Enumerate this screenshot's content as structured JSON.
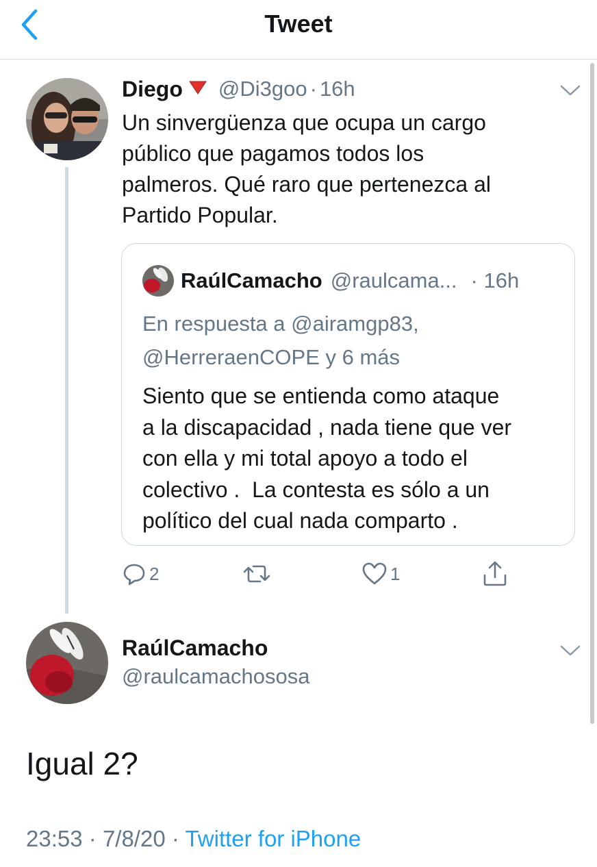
{
  "header": {
    "title": "Tweet",
    "back_icon": "chevron-left-icon"
  },
  "colors": {
    "accent": "#1da1f2",
    "text": "#14171a",
    "secondary": "#657786",
    "border": "#ccd6dd",
    "thread_line": "#cfd9de"
  },
  "tweet1": {
    "name": "Diego",
    "flag_icon": "red-down-triangle-icon",
    "handle": "@Di3goo",
    "sep": "·",
    "time": "16h",
    "text_lines": [
      "Un sinvergüenza que ocupa un cargo",
      "público que pagamos todos los",
      "palmeros. Qué raro que pertenezca al",
      "Partido Popular."
    ],
    "quote": {
      "name": "RaúlCamacho",
      "handle": "@raulcama...",
      "time": "· 16h",
      "reply_lines": [
        "En respuesta a @airamgp83,",
        "@HerreraenCOPE y 6 más"
      ],
      "text_lines": [
        "Siento que se entienda como ataque",
        "a la discapacidad , nada tiene que ver",
        "con ella y mi total apoyo a todo el",
        "colectivo .  La contesta es sólo a un",
        "político del cual nada comparto ."
      ]
    },
    "actions": {
      "reply_count": "2",
      "retweet_count": "",
      "like_count": "1"
    }
  },
  "tweet2": {
    "name": "RaúlCamacho",
    "handle": "@raulcamachososa",
    "text": "Igual 2?",
    "time": "23:53",
    "sep1": "·",
    "date": "7/8/20",
    "sep2": "·",
    "source": "Twitter for iPhone"
  }
}
